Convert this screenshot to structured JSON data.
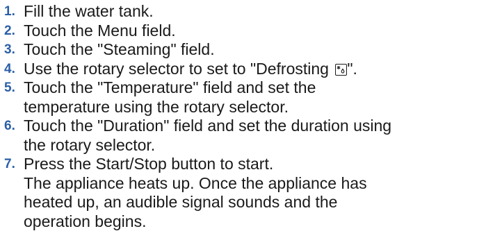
{
  "steps": [
    {
      "number": "1.",
      "text": "Fill the water tank."
    },
    {
      "number": "2.",
      "text": "Touch the Menu field."
    },
    {
      "number": "3.",
      "text": "Touch the \"Steaming\" field."
    },
    {
      "number": "4.",
      "text_before": "Use the rotary selector to set to \"Defrosting ",
      "icon": "defrost-icon",
      "text_after": "\"."
    },
    {
      "number": "5.",
      "text": "Touch the \"Temperature\" field and set the\ntemperature using the rotary selector."
    },
    {
      "number": "6.",
      "text": "Touch the \"Duration\" field and set the duration using\nthe rotary selector."
    },
    {
      "number": "7.",
      "text": "Press the Start/Stop button to start.\nThe appliance heats up. Once the appliance has\nheated up, an audible signal sounds and the\noperation begins."
    }
  ],
  "colors": {
    "step_number": "#2b5fa7",
    "text": "#1a1a1a"
  }
}
